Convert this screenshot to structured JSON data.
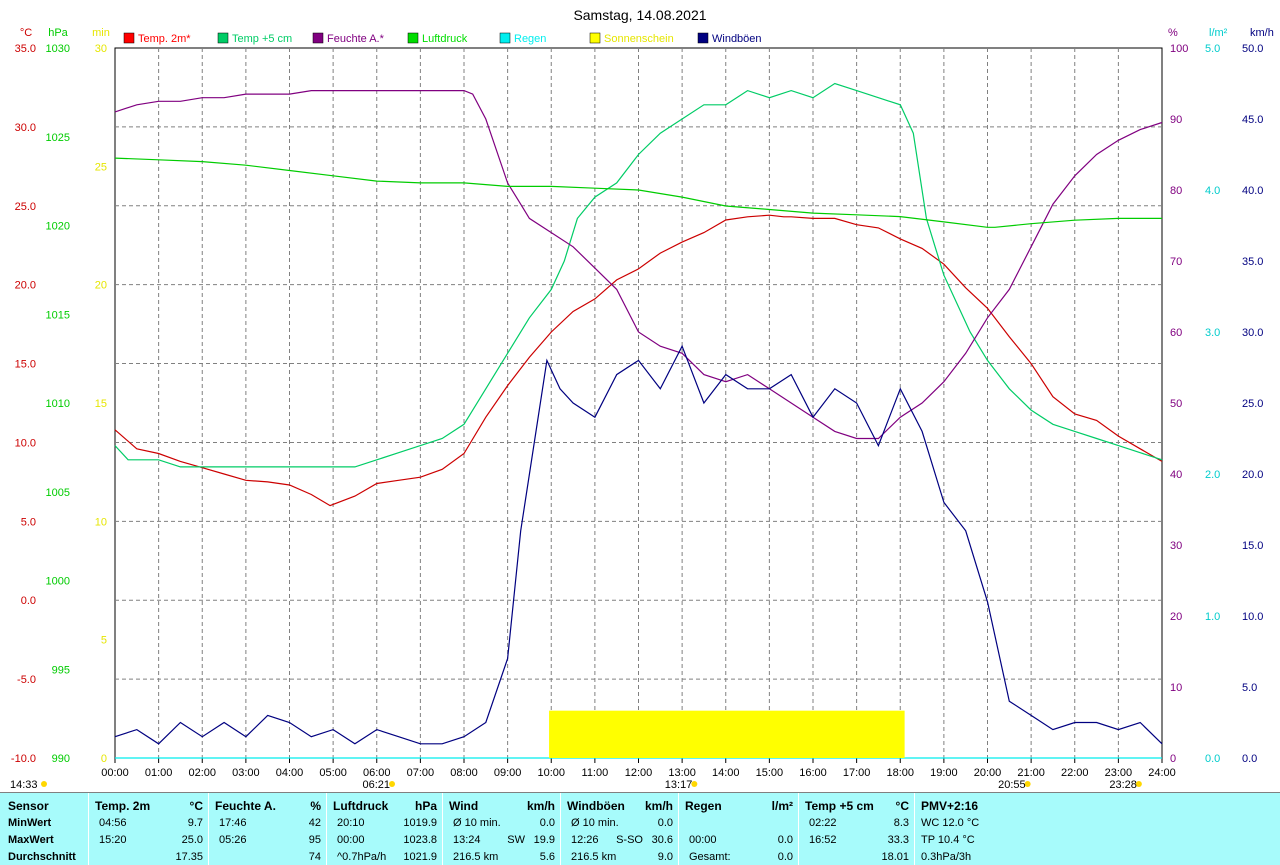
{
  "chart_data": {
    "type": "line",
    "title": "Samstag, 14.08.2021",
    "x_ticks": [
      "00:00",
      "01:00",
      "02:00",
      "03:00",
      "04:00",
      "05:00",
      "06:00",
      "07:00",
      "08:00",
      "09:00",
      "10:00",
      "11:00",
      "12:00",
      "13:00",
      "14:00",
      "15:00",
      "16:00",
      "17:00",
      "18:00",
      "19:00",
      "20:00",
      "21:00",
      "22:00",
      "23:00",
      "24:00"
    ],
    "axes": [
      {
        "id": "temp",
        "unit": "°C",
        "color": "#cc0000",
        "min": -10,
        "max": 35,
        "ticks": [
          "-10.0",
          "-5.0",
          "0.0",
          "5.0",
          "10.0",
          "15.0",
          "20.0",
          "25.0",
          "30.0",
          "35.0"
        ]
      },
      {
        "id": "press",
        "unit": "hPa",
        "color": "#00cc00",
        "min": 990,
        "max": 1030,
        "ticks": [
          "990",
          "995",
          "1000",
          "1005",
          "1010",
          "1015",
          "1020",
          "1025",
          "1030"
        ]
      },
      {
        "id": "sun",
        "unit": "min",
        "color": "#e6e600",
        "min": 0,
        "max": 30,
        "ticks": [
          "0",
          "5",
          "10",
          "15",
          "20",
          "25",
          "30"
        ]
      },
      {
        "id": "hum",
        "unit": "%",
        "color": "#800080",
        "min": 0,
        "max": 100,
        "ticks": [
          "0",
          "10",
          "20",
          "30",
          "40",
          "50",
          "60",
          "70",
          "80",
          "90",
          "100"
        ]
      },
      {
        "id": "rain",
        "unit": "l/m²",
        "color": "#00cccc",
        "min": 0,
        "max": 5,
        "ticks": [
          "0.0",
          "1.0",
          "2.0",
          "3.0",
          "4.0",
          "5.0"
        ]
      },
      {
        "id": "wind",
        "unit": "km/h",
        "color": "#000080",
        "min": 0,
        "max": 50,
        "ticks": [
          "0.0",
          "5.0",
          "10.0",
          "15.0",
          "20.0",
          "25.0",
          "30.0",
          "35.0",
          "40.0",
          "45.0",
          "50.0"
        ]
      }
    ],
    "legend": [
      {
        "name": "Temp. 2m*",
        "color": "#ff0000"
      },
      {
        "name": "Temp +5 cm",
        "color": "#00cc66"
      },
      {
        "name": "Feuchte A.*",
        "color": "#800080"
      },
      {
        "name": "Luftdruck",
        "color": "#00dd00"
      },
      {
        "name": "Regen",
        "color": "#00eeee"
      },
      {
        "name": "Sonnenschein",
        "color": "#ffff00"
      },
      {
        "name": "Windböen",
        "color": "#000080"
      }
    ],
    "series": [
      {
        "name": "Temp. 2m*",
        "axis": "temp",
        "color": "#cc0000",
        "x": [
          0,
          0.5,
          1,
          1.5,
          2,
          2.5,
          3,
          3.5,
          4,
          4.5,
          4.93,
          5.5,
          6,
          6.5,
          7,
          7.5,
          8,
          8.5,
          9,
          9.5,
          10,
          10.5,
          11,
          11.5,
          12,
          12.5,
          13,
          13.5,
          14,
          14.5,
          15,
          15.33,
          15.5,
          16,
          16.5,
          17,
          17.5,
          18,
          18.5,
          19,
          19.5,
          20,
          20.5,
          21,
          21.5,
          22,
          22.5,
          23,
          23.5,
          24
        ],
        "y": [
          10.8,
          9.6,
          9.3,
          8.8,
          8.4,
          8.0,
          7.6,
          7.5,
          7.3,
          6.7,
          6.0,
          6.6,
          7.4,
          7.6,
          7.8,
          8.3,
          9.3,
          11.6,
          13.6,
          15.4,
          17.0,
          18.3,
          19.1,
          20.3,
          21.0,
          22.0,
          22.7,
          23.3,
          24.1,
          24.3,
          24.4,
          24.3,
          24.3,
          24.2,
          24.2,
          23.8,
          23.6,
          22.9,
          22.3,
          21.3,
          19.8,
          18.5,
          16.7,
          15.0,
          12.9,
          11.8,
          11.4,
          10.4,
          9.6,
          8.8
        ]
      },
      {
        "name": "Temp +5 cm",
        "axis": "rain",
        "color": "#00cc66",
        "x": [
          0,
          0.3,
          1,
          1.5,
          2,
          2.5,
          3,
          3.5,
          4,
          4.5,
          5,
          5.5,
          6,
          6.5,
          7,
          7.5,
          8,
          8.5,
          9,
          9.5,
          10,
          10.3,
          10.6,
          11,
          11.5,
          12,
          12.5,
          13,
          13.5,
          14,
          14.5,
          15,
          15.5,
          16,
          16.5,
          17,
          17.5,
          18,
          18.3,
          18.6,
          18.8,
          19,
          19.3,
          19.6,
          20,
          20.5,
          21,
          21.5,
          22,
          22.5,
          23,
          23.5,
          24
        ],
        "y": [
          2.2,
          2.1,
          2.1,
          2.05,
          2.05,
          2.05,
          2.05,
          2.05,
          2.05,
          2.05,
          2.05,
          2.05,
          2.1,
          2.15,
          2.2,
          2.25,
          2.35,
          2.6,
          2.85,
          3.1,
          3.3,
          3.5,
          3.8,
          3.95,
          4.05,
          4.25,
          4.4,
          4.5,
          4.6,
          4.6,
          4.7,
          4.65,
          4.7,
          4.65,
          4.75,
          4.7,
          4.65,
          4.6,
          4.4,
          3.8,
          3.6,
          3.4,
          3.2,
          3.0,
          2.8,
          2.6,
          2.45,
          2.35,
          2.3,
          2.25,
          2.2,
          2.15,
          2.1
        ]
      },
      {
        "name": "Feuchte A.*",
        "axis": "hum",
        "color": "#800080",
        "x": [
          0,
          0.5,
          1,
          1.5,
          2,
          2.5,
          3,
          3.5,
          4,
          4.5,
          5,
          5.5,
          6,
          6.5,
          7,
          7.5,
          8,
          8.2,
          8.5,
          9,
          9.3,
          9.5,
          10,
          10.5,
          11,
          11.5,
          12,
          12.5,
          13,
          13.5,
          14,
          14.5,
          15,
          15.5,
          16,
          16.5,
          17,
          17.5,
          18,
          18.5,
          19,
          19.5,
          20,
          20.5,
          21,
          21.5,
          22,
          22.5,
          23,
          23.5,
          24
        ],
        "y": [
          91,
          92,
          92.5,
          92.5,
          93,
          93,
          93.5,
          93.5,
          93.5,
          94,
          94,
          94,
          94,
          94,
          94,
          94,
          94,
          93.5,
          90,
          81,
          78,
          76,
          74,
          72,
          69,
          66,
          60,
          58,
          57,
          54,
          53,
          54,
          52,
          50,
          48,
          46,
          45,
          45,
          48,
          50,
          53,
          57,
          62,
          66,
          72,
          78,
          82,
          85,
          87,
          88.5,
          89.5
        ]
      },
      {
        "name": "Luftdruck",
        "axis": "press",
        "color": "#00cc00",
        "x": [
          0,
          1,
          2,
          3,
          4,
          5,
          6,
          7,
          8,
          9,
          10,
          11,
          12,
          13,
          14,
          15,
          16,
          17,
          18,
          19,
          20,
          20.17,
          21,
          22,
          23,
          24
        ],
        "y": [
          1023.8,
          1023.7,
          1023.6,
          1023.4,
          1023.1,
          1022.8,
          1022.5,
          1022.4,
          1022.4,
          1022.2,
          1022.2,
          1022.1,
          1022.0,
          1021.6,
          1021.1,
          1020.9,
          1020.7,
          1020.6,
          1020.5,
          1020.2,
          1019.9,
          1019.9,
          1020.1,
          1020.3,
          1020.4,
          1020.4
        ]
      },
      {
        "name": "Regen",
        "axis": "rain",
        "color": "#00eeee",
        "x": [
          0,
          24
        ],
        "y": [
          0,
          0
        ]
      },
      {
        "name": "Sonnenschein",
        "axis": "sun",
        "color": "#ffff00",
        "type": "area",
        "x": [
          9.95,
          18.1
        ],
        "y": [
          2,
          2
        ]
      },
      {
        "name": "Windböen",
        "axis": "wind",
        "color": "#000080",
        "x": [
          0,
          0.5,
          1,
          1.5,
          2,
          2.5,
          3,
          3.5,
          4,
          4.5,
          5,
          5.5,
          6,
          6.5,
          7,
          7.5,
          8,
          8.5,
          9,
          9.3,
          9.6,
          9.9,
          10.2,
          10.5,
          11,
          11.5,
          12,
          12.5,
          13,
          13.5,
          14,
          14.5,
          15,
          15.5,
          16,
          16.5,
          17,
          17.5,
          18,
          18.5,
          19,
          19.5,
          20,
          20.5,
          21,
          21.5,
          22,
          22.5,
          23,
          23.5,
          24
        ],
        "y": [
          1.5,
          2,
          1,
          2.5,
          1.5,
          2.5,
          1.5,
          3,
          2.5,
          1.5,
          2,
          1,
          2,
          1.5,
          1,
          1,
          1.5,
          2.5,
          7,
          16,
          22,
          28,
          26,
          25,
          24,
          27,
          28,
          26,
          29,
          25,
          27,
          26,
          26,
          27,
          24,
          26,
          25,
          22,
          26,
          23,
          18,
          16,
          11,
          4,
          3,
          2,
          2.5,
          2.5,
          2,
          2.5,
          1
        ]
      }
    ],
    "markers": [
      {
        "label": "14:33",
        "x": -0.3,
        "where": "bottom-left"
      },
      {
        "label": "06:21",
        "x": 6.35,
        "where": "bottom"
      },
      {
        "label": "13:17",
        "x": 13.28,
        "where": "bottom"
      },
      {
        "label": "20:55",
        "x": 20.92,
        "where": "bottom"
      },
      {
        "label": "23:28",
        "x": 23.47,
        "where": "bottom"
      }
    ]
  },
  "stats": {
    "row_labels": [
      "Sensor",
      "MinWert",
      "MaxWert",
      "Durchschnitt"
    ],
    "columns": [
      {
        "title": "Temp. 2m",
        "unit": "°C",
        "rows": [
          {
            "time": "04:56",
            "value": "9.7"
          },
          {
            "time": "15:20",
            "value": "25.0"
          },
          {
            "time": "",
            "value": "17.35"
          }
        ]
      },
      {
        "title": "Feuchte A.",
        "unit": "%",
        "rows": [
          {
            "time": "17:46",
            "value": "42"
          },
          {
            "time": "05:26",
            "value": "95"
          },
          {
            "time": "",
            "value": "74"
          }
        ]
      },
      {
        "title": "Luftdruck",
        "unit": "hPa",
        "rows": [
          {
            "time": "20:10",
            "value": "1019.9"
          },
          {
            "time": "00:00",
            "value": "1023.8"
          },
          {
            "time": "^0.7hPa/h",
            "value": "1021.9"
          }
        ]
      },
      {
        "title": "Wind",
        "unit": "km/h",
        "rows": [
          {
            "time": "Ø 10 min.",
            "value": "0.0"
          },
          {
            "time": "13:24",
            "extra": "SW",
            "value": "19.9"
          },
          {
            "time": "216.5 km",
            "value": "5.6"
          }
        ]
      },
      {
        "title": "Windböen",
        "unit": "km/h",
        "rows": [
          {
            "time": "Ø 10 min.",
            "value": "0.0"
          },
          {
            "time": "12:26",
            "extra": "S-SO",
            "value": "30.6"
          },
          {
            "time": "216.5 km",
            "value": "9.0"
          }
        ]
      },
      {
        "title": "Regen",
        "unit": "l/m²",
        "rows": [
          {
            "time": "",
            "value": ""
          },
          {
            "time": "00:00",
            "value": "0.0"
          },
          {
            "time": "Gesamt:",
            "value": "0.0"
          }
        ]
      },
      {
        "title": "Temp +5 cm",
        "unit": "°C",
        "rows": [
          {
            "time": "02:22",
            "value": "8.3"
          },
          {
            "time": "16:52",
            "value": "33.3"
          },
          {
            "time": "",
            "value": "18.01"
          }
        ]
      },
      {
        "title": "PMV+2:16",
        "unit": "",
        "rows": [
          {
            "time": "WC 12.0 °C",
            "value": ""
          },
          {
            "time": "TP 10.4 °C",
            "value": ""
          },
          {
            "time": "0.3hPa/3h",
            "value": ""
          }
        ]
      }
    ]
  }
}
